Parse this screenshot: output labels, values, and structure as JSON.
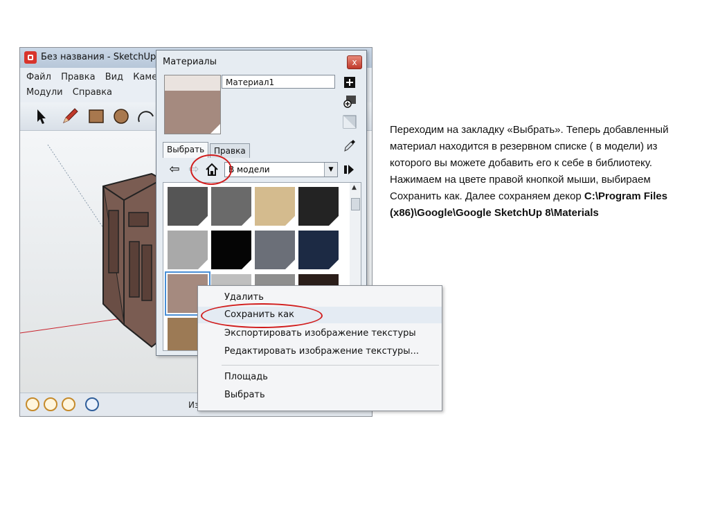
{
  "main_window": {
    "title": "Без названия - SketchUp",
    "menu_row1": [
      "Файл",
      "Правка",
      "Вид",
      "Камера"
    ],
    "menu_row2": [
      "Модули",
      "Справка"
    ],
    "tool_icons": [
      "select-arrow-icon",
      "pencil-icon",
      "rectangle-icon",
      "circle-icon",
      "arc-icon"
    ],
    "status_icons": [
      "lightbulb-icon",
      "info-icon",
      "credits-icon",
      "help-icon"
    ],
    "measure_label": "Измерения"
  },
  "materials": {
    "title": "Материалы",
    "close": "x",
    "name_value": "Материал1",
    "preview_color": "#a58a7f",
    "tabs": [
      "Выбрать",
      "Правка"
    ],
    "collection": "В модели",
    "swatches": [
      {
        "color": "#555555"
      },
      {
        "color": "#6a6a6a"
      },
      {
        "color": "#d4bb8e"
      },
      {
        "color": "#232323"
      },
      {
        "color": "#a9a9a9"
      },
      {
        "color": "#050505"
      },
      {
        "color": "#6b6f78"
      },
      {
        "color": "#1c2a44"
      },
      {
        "color": "#a58a7f"
      },
      {
        "color": "#bfbfbf"
      },
      {
        "color": "#8e8e8e"
      },
      {
        "color": "#2b1e1a"
      },
      {
        "color": "#9c7a55"
      }
    ]
  },
  "context_menu": {
    "items": [
      "Удалить",
      "Сохранить как",
      "Экспортировать изображение текстуры",
      "Редактировать изображение текстуры...",
      "Площадь",
      "Выбрать"
    ]
  },
  "explanation": {
    "line1": "Переходим на закладку «Выбрать». Теперь добавленный материал находится в резервном списке ( в модели) из которого вы можете добавить его к себе в библиотеку.",
    "line2": "Нажимаем на цвете правой кнопкой мыши, выбираем Сохранить как. Далее сохраняем декор",
    "path": "C:\\Program Files (x86)\\Google\\Google SketchUp 8\\Materials"
  },
  "colors": {
    "annotation_red": "#d11c1c",
    "selection_blue": "#4a8fd6"
  }
}
